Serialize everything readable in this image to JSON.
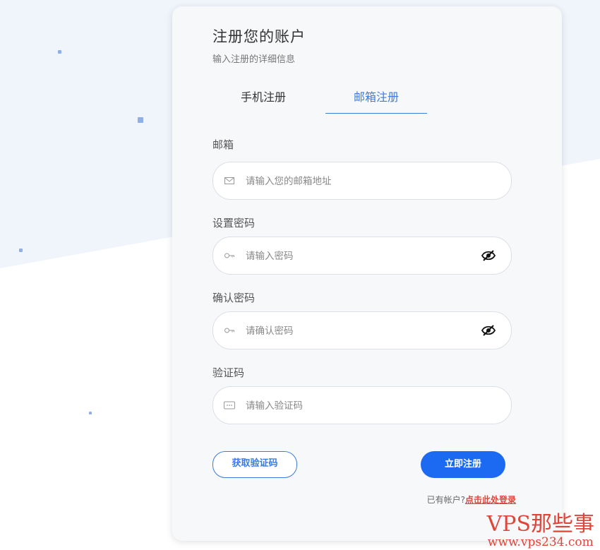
{
  "header": {
    "title": "注册您的账户",
    "subtitle": "输入注册的详细信息"
  },
  "tabs": [
    {
      "label": "手机注册",
      "active": false
    },
    {
      "label": "邮箱注册",
      "active": true
    }
  ],
  "form": {
    "email": {
      "label": "邮箱",
      "placeholder": "请输入您的邮箱地址",
      "icon": "mail-icon"
    },
    "password": {
      "label": "设置密码",
      "placeholder": "请输入密码",
      "icon": "key-icon"
    },
    "confirm": {
      "label": "确认密码",
      "placeholder": "请确认密码",
      "icon": "key-icon"
    },
    "code": {
      "label": "验证码",
      "placeholder": "请输入验证码",
      "icon": "keyboard-icon"
    }
  },
  "buttons": {
    "get_code": "获取验证码",
    "register": "立即注册"
  },
  "login": {
    "prompt": "已有帐户?",
    "link": "点击此处登录"
  },
  "watermark": {
    "line1": "VPS那些事",
    "line2": "www.vps234.com"
  },
  "colors": {
    "accent": "#3a7be0",
    "primary_button": "#1d6af2",
    "link": "#e0453a",
    "background_tint": "#eef3fc"
  }
}
